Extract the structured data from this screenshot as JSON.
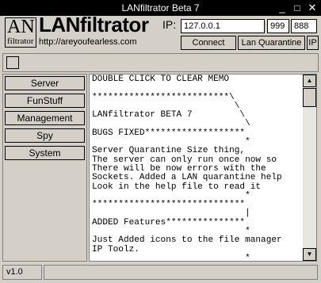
{
  "window": {
    "title": "LANfiltrator Beta 7",
    "minimize_glyph": "_",
    "maximize_glyph": "□",
    "close_glyph": "✕"
  },
  "header": {
    "logo_main": "AN",
    "logo_sub": "filtrator",
    "brand": "LANfiltrator",
    "url": "http://areyoufearless.com"
  },
  "connection": {
    "ip_label": "IP:",
    "ip_value": "127.0.0.1",
    "port1_value": "999",
    "port2_value": "888",
    "connect_label": "Connect",
    "lan_quarantine_label": "Lan Quarantine",
    "ip_button_label": "IP"
  },
  "sidebar": {
    "items": [
      {
        "label": "Server"
      },
      {
        "label": "FunStuff"
      },
      {
        "label": "Management"
      },
      {
        "label": "Spy"
      },
      {
        "label": "System"
      }
    ]
  },
  "memo": {
    "text": "DOUBLE CLICK TO CLEAR MEMO\n\n**************************\\\n                           \\\nLANfiltrator BETA 7         \\\n                             \\\nBUGS FIXED*******************\n                             *\nServer Quarantine Size thing,\nThe server can only run once now so\nThere will be now errors with the\nSockets. Added a LAN quarantine help\nLook in the help file to read it\n                             *\n*****************************\n                             |\nADDED Features***************\n                             *\nJust Added icons to the file manager\nIP Toolz.\n                             *",
    "scroll_up_glyph": "▲",
    "scroll_down_glyph": "▼"
  },
  "status": {
    "version": "v1.0",
    "message": ""
  }
}
